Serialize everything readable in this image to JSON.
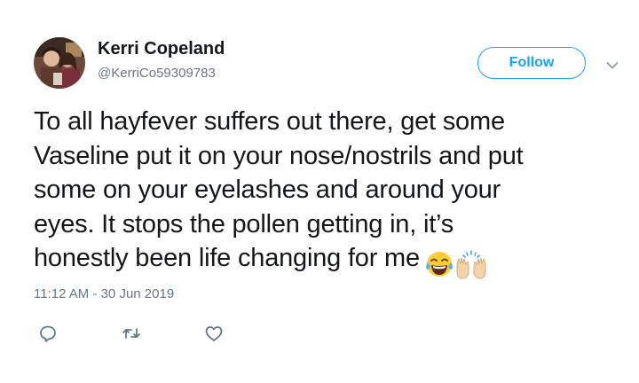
{
  "tweet": {
    "author": {
      "display_name": "Kerri Copeland",
      "handle": "@KerriCo59309783",
      "avatar": "avatar-photo"
    },
    "follow_label": "Follow",
    "text_lines": [
      "To all hayfever suffers out there, get some",
      "Vaseline put it on your nose/nostrils and put",
      "some on your eyelashes and around your",
      "eyes. It stops the pollen getting in, it’s",
      "honestly been life changing for me"
    ],
    "emojis": [
      "face-with-tears-of-joy",
      "raising-hands"
    ],
    "timestamp": "11:12 AM - 30 Jun 2019",
    "actions": [
      "reply-icon",
      "retweet-icon",
      "like-icon"
    ],
    "colors": {
      "accent": "#1da1f2",
      "text": "#14171a",
      "muted": "#657786"
    }
  }
}
